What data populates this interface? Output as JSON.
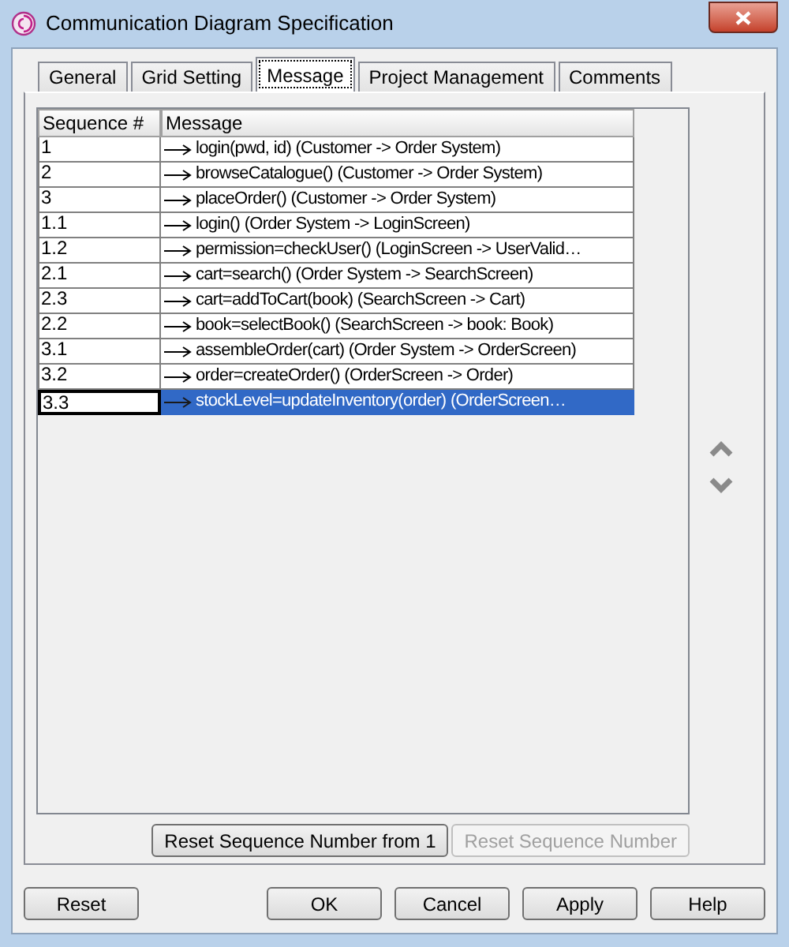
{
  "window": {
    "title": "Communication Diagram Specification"
  },
  "tabs": [
    {
      "label": "General",
      "selected": false
    },
    {
      "label": "Grid Setting",
      "selected": false
    },
    {
      "label": "Message",
      "selected": true
    },
    {
      "label": "Project Management",
      "selected": false
    },
    {
      "label": "Comments",
      "selected": false
    }
  ],
  "table": {
    "columns": [
      "Sequence #",
      "Message"
    ],
    "rows": [
      {
        "sequence": "1",
        "message": "login(pwd, id) (Customer -> Order System)",
        "selected": false
      },
      {
        "sequence": "2",
        "message": "browseCatalogue() (Customer -> Order System)",
        "selected": false
      },
      {
        "sequence": "3",
        "message": "placeOrder() (Customer -> Order System)",
        "selected": false
      },
      {
        "sequence": "1.1",
        "message": "login() (Order System -> LoginScreen)",
        "selected": false
      },
      {
        "sequence": "1.2",
        "message": "permission=checkUser() (LoginScreen -> UserValid…",
        "selected": false
      },
      {
        "sequence": "2.1",
        "message": "cart=search() (Order System -> SearchScreen)",
        "selected": false
      },
      {
        "sequence": "2.3",
        "message": "cart=addToCart(book) (SearchScreen -> Cart)",
        "selected": false
      },
      {
        "sequence": "2.2",
        "message": "book=selectBook() (SearchScreen -> book: Book)",
        "selected": false
      },
      {
        "sequence": "3.1",
        "message": "assembleOrder(cart) (Order System -> OrderScreen)",
        "selected": false
      },
      {
        "sequence": "3.2",
        "message": "order=createOrder() (OrderScreen -> Order)",
        "selected": false
      },
      {
        "sequence": "3.3",
        "message": "stockLevel=updateInventory(order) (OrderScreen…",
        "selected": true
      }
    ]
  },
  "panel_buttons": [
    {
      "label": "Reset Sequence Number from 1",
      "disabled": false
    },
    {
      "label": "Reset Sequence Number",
      "disabled": true
    }
  ],
  "footer": {
    "left": [
      {
        "label": "Reset"
      }
    ],
    "right": [
      {
        "label": "OK"
      },
      {
        "label": "Cancel"
      },
      {
        "label": "Apply"
      },
      {
        "label": "Help"
      }
    ]
  }
}
